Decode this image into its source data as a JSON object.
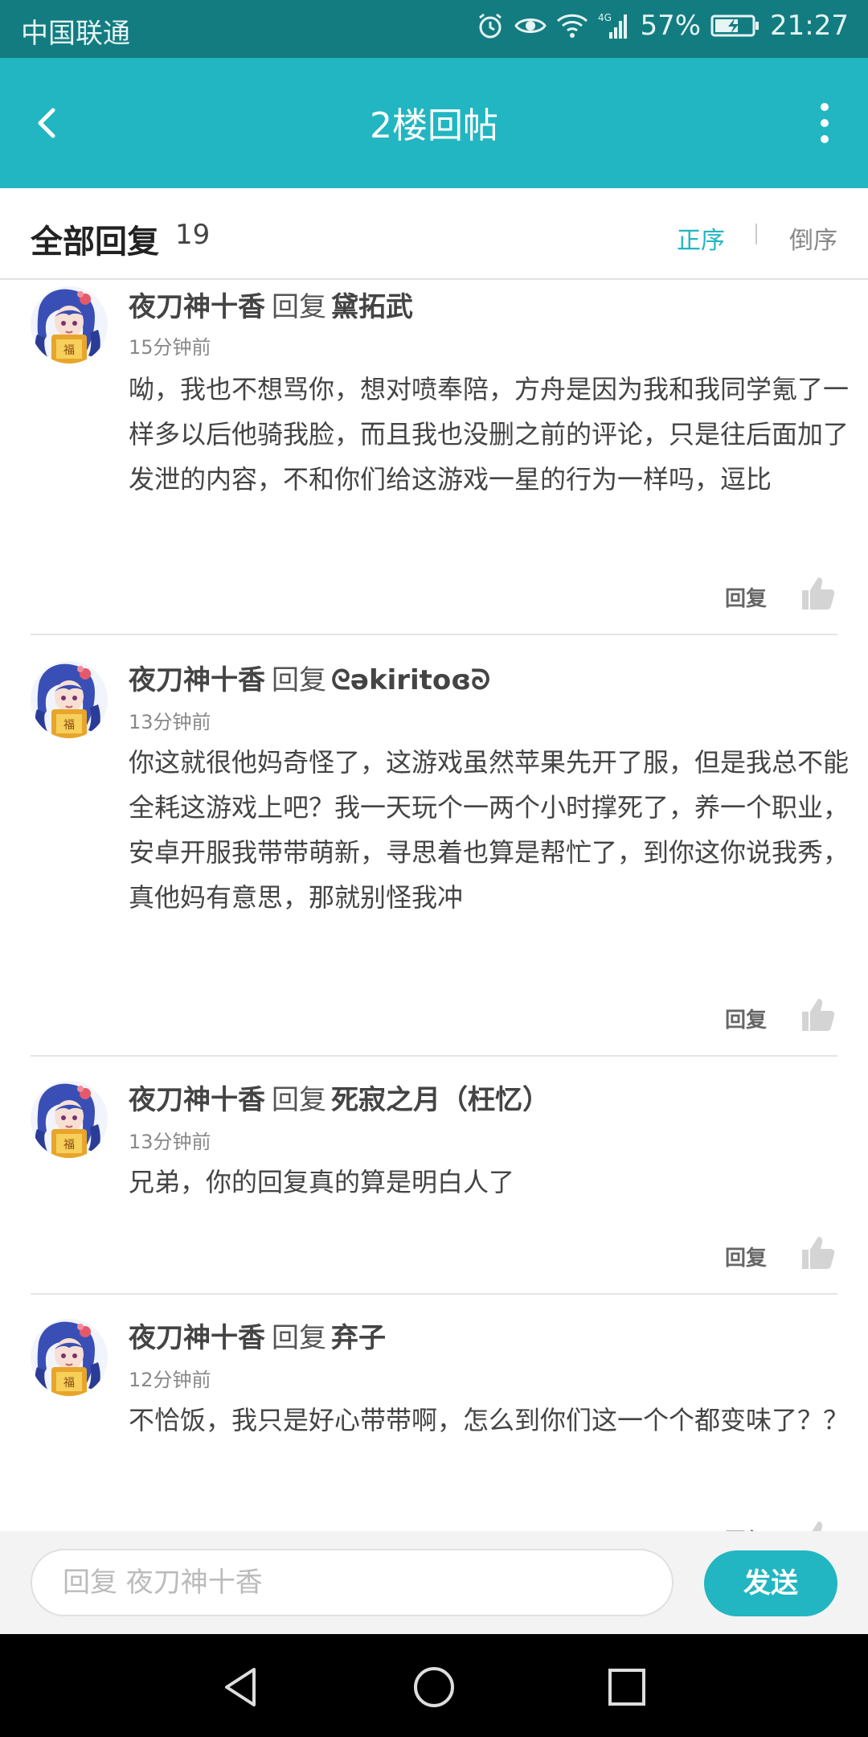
{
  "status_bar": {
    "carrier": "中国联通",
    "battery": "57%",
    "time": "21:27",
    "network": "4G",
    "icons": [
      "alarm-icon",
      "eye-icon",
      "wifi-icon",
      "signal-icon",
      "battery-icon"
    ]
  },
  "header": {
    "title": "2楼回帖",
    "icons": [
      "back-icon",
      "more-icon"
    ],
    "background": "#21b6c1"
  },
  "section": {
    "title": "全部回复",
    "count": "19",
    "sort_asc": "正序",
    "sort_desc": "倒序",
    "accent": "#21b6c1"
  },
  "comments": [
    {
      "author": "夜刀神十香",
      "reply_word": "回复",
      "target": "黛拓武",
      "time": "15分钟前",
      "text": "呦，我也不想骂你，想对喷奉陪，方舟是因为我和我同学氪了一样多以后他骑我脸，而且我也没删之前的评论，只是往后面加了发泄的内容，不和你们给这游戏一星的行为一样吗，逗比",
      "reply_label": "回复"
    },
    {
      "author": "夜刀神十香",
      "reply_word": "回复",
      "target": "ᘓəkiritoɞᘐ",
      "time": "13分钟前",
      "text": "你这就很他妈奇怪了，这游戏虽然苹果先开了服，但是我总不能全耗这游戏上吧？我一天玩个一两个小时撑死了，养一个职业，安卓开服我带带萌新，寻思着也算是帮忙了，到你这你说我秀，真他妈有意思，那就别怪我冲",
      "reply_label": "回复"
    },
    {
      "author": "夜刀神十香",
      "reply_word": "回复",
      "target": "死寂之月（枉忆）",
      "time": "13分钟前",
      "text": "兄弟，你的回复真的算是明白人了",
      "reply_label": "回复"
    },
    {
      "author": "夜刀神十香",
      "reply_word": "回复",
      "target": "弃子",
      "time": "12分钟前",
      "text": "不恰饭，我只是好心带带啊，怎么到你们这一个个都变味了？？",
      "reply_label": "回复"
    }
  ],
  "footer": {
    "input_placeholder": "回复 夜刀神十香",
    "send_label": "发送"
  },
  "nav": {
    "icons": [
      "nav-back-icon",
      "nav-home-icon",
      "nav-recents-icon"
    ]
  }
}
